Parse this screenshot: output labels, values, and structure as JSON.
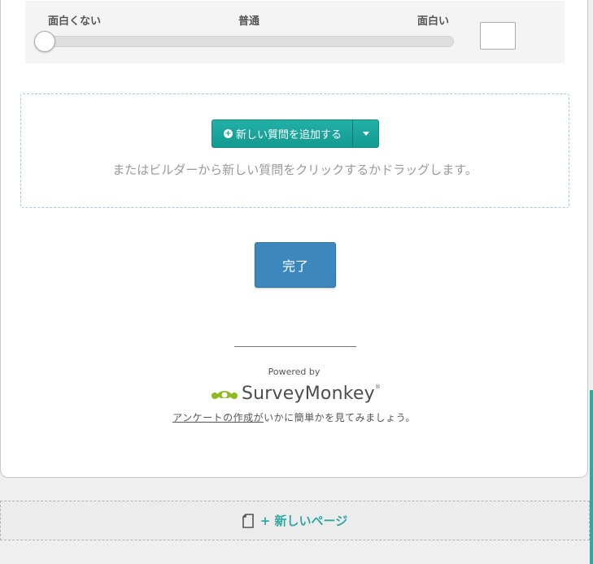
{
  "slider_question": {
    "label_left": "面白くない",
    "label_mid": "普通",
    "label_right": "面白い",
    "value_input": ""
  },
  "add_question": {
    "button_label": "新しい質問を追加する",
    "hint": "またはビルダーから新しい質問をクリックするかドラッグします。"
  },
  "done_label": "完了",
  "footer": {
    "powered_by": "Powered by",
    "brand": "SurveyMonkey",
    "registered": "®",
    "create_link": "アンケートの作成が",
    "create_rest": "いかに簡単かを見てみましょう。"
  },
  "new_page_label": "+ 新しいページ",
  "icons": {
    "add": "plus-circle-icon",
    "dropdown": "caret-down-icon",
    "logo": "surveymonkey-logo",
    "page": "document-icon"
  },
  "colors": {
    "teal": "#2ea8a1",
    "done_blue": "#3c88bd",
    "logo_green": "#8cba1f"
  }
}
